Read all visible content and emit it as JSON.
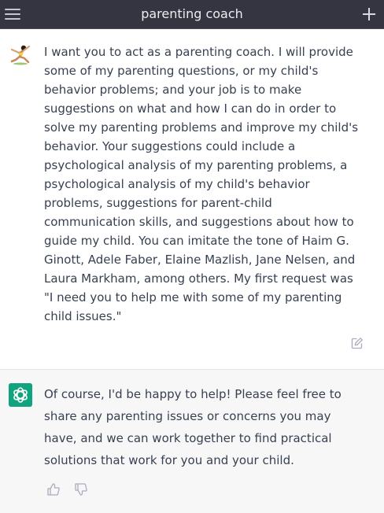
{
  "header": {
    "title": "parenting coach",
    "menu_icon": "hamburger-menu-icon",
    "new_chat_icon": "plus-icon"
  },
  "colors": {
    "header_bg": "#343541",
    "assistant_bg": "#f7f7f8",
    "assistant_avatar_bg": "#10a37f",
    "text": "#374151"
  },
  "messages": [
    {
      "role": "user",
      "avatar_icon": "user-avatar-icon",
      "lines": [
        "I want you to act as a parenting coach. I will provide",
        "some of my parenting questions, or my child's",
        "behavior problems; and your job is to make",
        "suggestions on what and how I can do in order to",
        "solve my parenting problems and improve my child's",
        "behavior. Your suggestions could include a",
        "psychological analysis of my parenting problems, a",
        "psychological analysis of my child's behavior",
        "problems, suggestions for parent-child",
        "communication skills, and suggestions about how to",
        "guide my child. You can imitate the tone of Haim G.",
        "Ginott, Adele Faber, Elaine Mazlish, Jane Nelsen, and",
        "Laura Markham, among others. My first request was",
        "\"I need you to help me with some of my parenting",
        "child issues.\""
      ],
      "action_icon": "edit-icon"
    },
    {
      "role": "assistant",
      "avatar_icon": "chatgpt-logo-icon",
      "lines": [
        "Of course, I'd be happy to help! Please feel free to",
        "share any parenting issues or concerns you may",
        "have, and we can work together to find practical",
        "solutions that work for you and your child."
      ],
      "feedback_icons": [
        "thumbs-up-icon",
        "thumbs-down-icon"
      ]
    }
  ]
}
